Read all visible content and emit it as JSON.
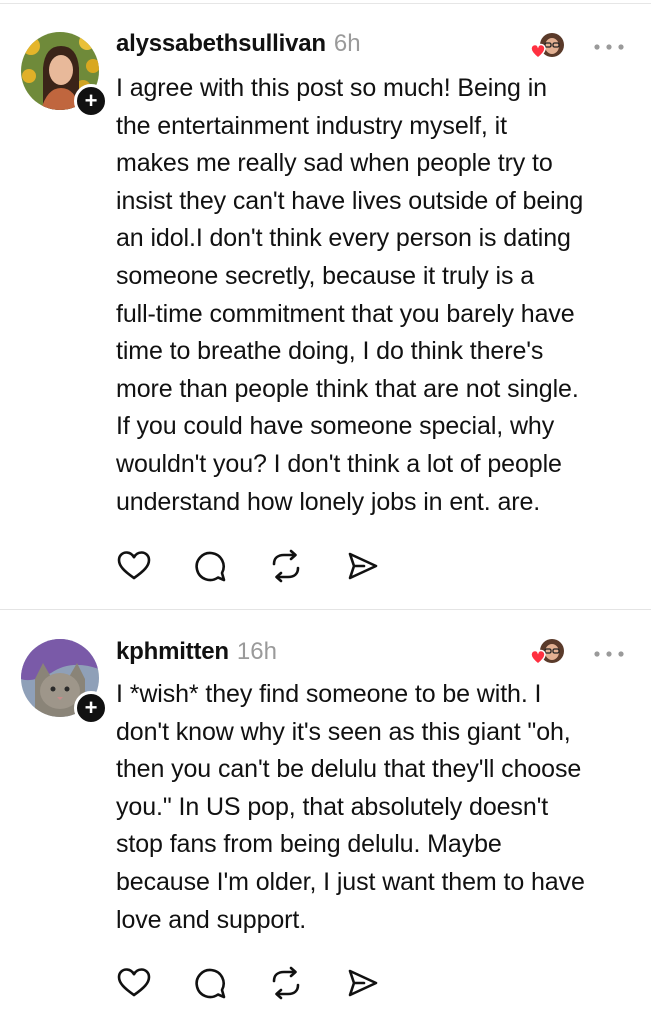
{
  "posts": [
    {
      "username": "alyssabethsullivan",
      "time": "6h",
      "text": "I agree with this post so much! Being in\nthe entertainment industry myself, it\nmakes me really sad when people try to\ninsist they can't have lives outside of being\nan idol.I don't think every person is dating\nsomeone secretly, because it truly is a\nfull-time commitment that you barely have\ntime to breathe doing, I do think there's\nmore than people think that are not single.\nIf you could have someone special, why\nwouldn't you? I don't think a lot of people\nunderstand how lonely jobs in ent.  are.",
      "follow_symbol": "+"
    },
    {
      "username": "kphmitten",
      "time": "16h",
      "text": "I *wish* they find someone to be with. I\ndon't know why it's seen as this giant \"oh,\nthen you can't be delulu that they'll choose\nyou.\" In US pop, that absolutely doesn't\nstop fans from being delulu. Maybe\nbecause I'm older, I just want them to have\nlove and support.",
      "follow_symbol": "+"
    }
  ],
  "icons": {
    "like": "heart-icon",
    "comment": "comment-bubble-icon",
    "repost": "repost-icon",
    "share": "send-icon",
    "more": "more-options-icon",
    "liked_by": "liked-by-author-avatar-icon"
  },
  "colors": {
    "text": "#111111",
    "muted": "#9a9a9a",
    "heart": "#ff3040",
    "divider": "#e4e4e4"
  }
}
